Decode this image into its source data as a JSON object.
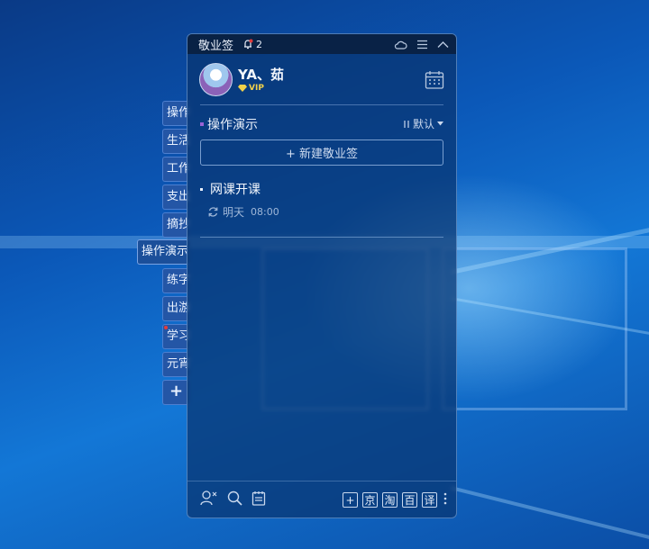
{
  "app_title": "敬业签",
  "notifications": {
    "count": "2"
  },
  "user": {
    "name": "YA、茹",
    "badge": "VIP"
  },
  "list": {
    "title": "操作演示",
    "sort_label": "默认"
  },
  "new_note_label": "+ 新建敬业签",
  "notes": [
    {
      "title": "网课开课",
      "date": "明天",
      "time": "08:00"
    }
  ],
  "side_tabs": [
    {
      "label": "操作"
    },
    {
      "label": "生活"
    },
    {
      "label": "工作"
    },
    {
      "label": "支出"
    },
    {
      "label": "摘抄"
    },
    {
      "label": "操作演示",
      "active": true
    },
    {
      "label": "练字"
    },
    {
      "label": "出游"
    },
    {
      "label": "学习",
      "unread": true
    },
    {
      "label": "元宵"
    },
    {
      "label": "+"
    }
  ],
  "bottom_shortcuts": [
    "+",
    "京",
    "淘",
    "百",
    "译"
  ],
  "colors": {
    "accent": "#9a63d6",
    "vip": "#f2d14a",
    "alert": "#e03c3c"
  }
}
